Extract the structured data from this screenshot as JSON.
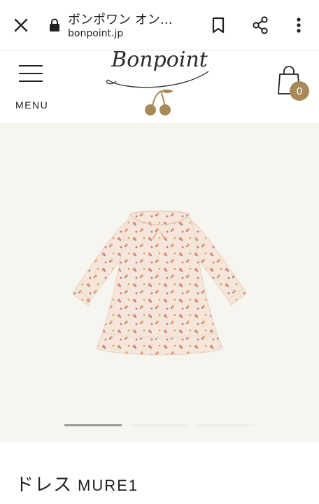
{
  "browser": {
    "page_title": "ボンポワン オン…",
    "url": "bonpoint.jp",
    "icons": [
      "close-icon",
      "lock-icon",
      "bookmark-icon",
      "share-icon",
      "more-vert-icon"
    ]
  },
  "header": {
    "menu_label": "MENU",
    "logo_text": "Bonpoint",
    "cart_count": "0",
    "colors": {
      "accent": "#a8895a"
    }
  },
  "product": {
    "image_alt_subject": "dress",
    "name": "ドレス",
    "code": "MURE1",
    "slider": {
      "total": 3,
      "active": 1
    },
    "colors": {
      "image_bg": "#f6f5f0"
    }
  }
}
